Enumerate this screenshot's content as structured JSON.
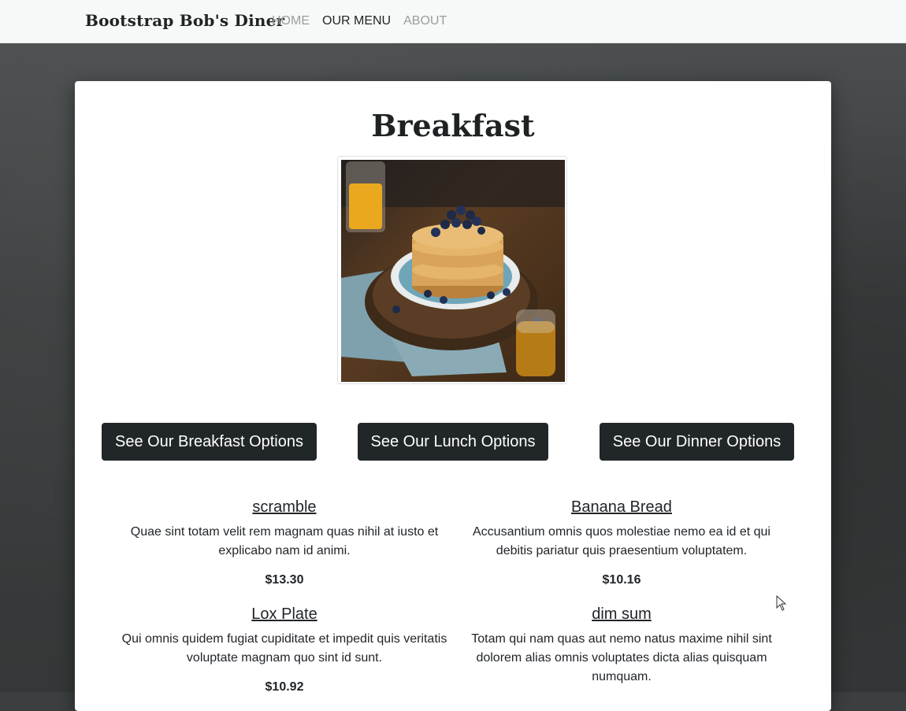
{
  "navbar": {
    "brand": "Bootstrap Bob's Diner",
    "links": [
      {
        "label": "HOME",
        "active": false
      },
      {
        "label": "OUR MENU",
        "active": true
      },
      {
        "label": "ABOUT",
        "active": false
      }
    ]
  },
  "main": {
    "title": "Breakfast",
    "buttons": {
      "breakfast": "See Our Breakfast Options",
      "lunch": "See Our Lunch Options",
      "dinner": "See Our Dinner Options"
    },
    "items": [
      {
        "name": "scramble",
        "description": "Quae sint totam velit rem magnam quas nihil at iusto et explicabo nam id animi.",
        "price": "$13.30"
      },
      {
        "name": "Banana Bread",
        "description": "Accusantium omnis quos molestiae nemo ea id et qui debitis pariatur quis praesentium voluptatem.",
        "price": "$10.16"
      },
      {
        "name": "Lox Plate",
        "description": "Qui omnis quidem fugiat cupiditate et impedit quis veritatis voluptate magnam quo sint id sunt.",
        "price": "$10.92"
      },
      {
        "name": "dim sum",
        "description": "Totam qui nam quas aut nemo natus maxime nihil sint dolorem alias omnis voluptates dicta alias quisquam numquam.",
        "price": ""
      }
    ]
  },
  "colors": {
    "button_bg": "#212629",
    "nav_bg": "#f7f8f8",
    "page_bg": "#3b3f3f"
  }
}
